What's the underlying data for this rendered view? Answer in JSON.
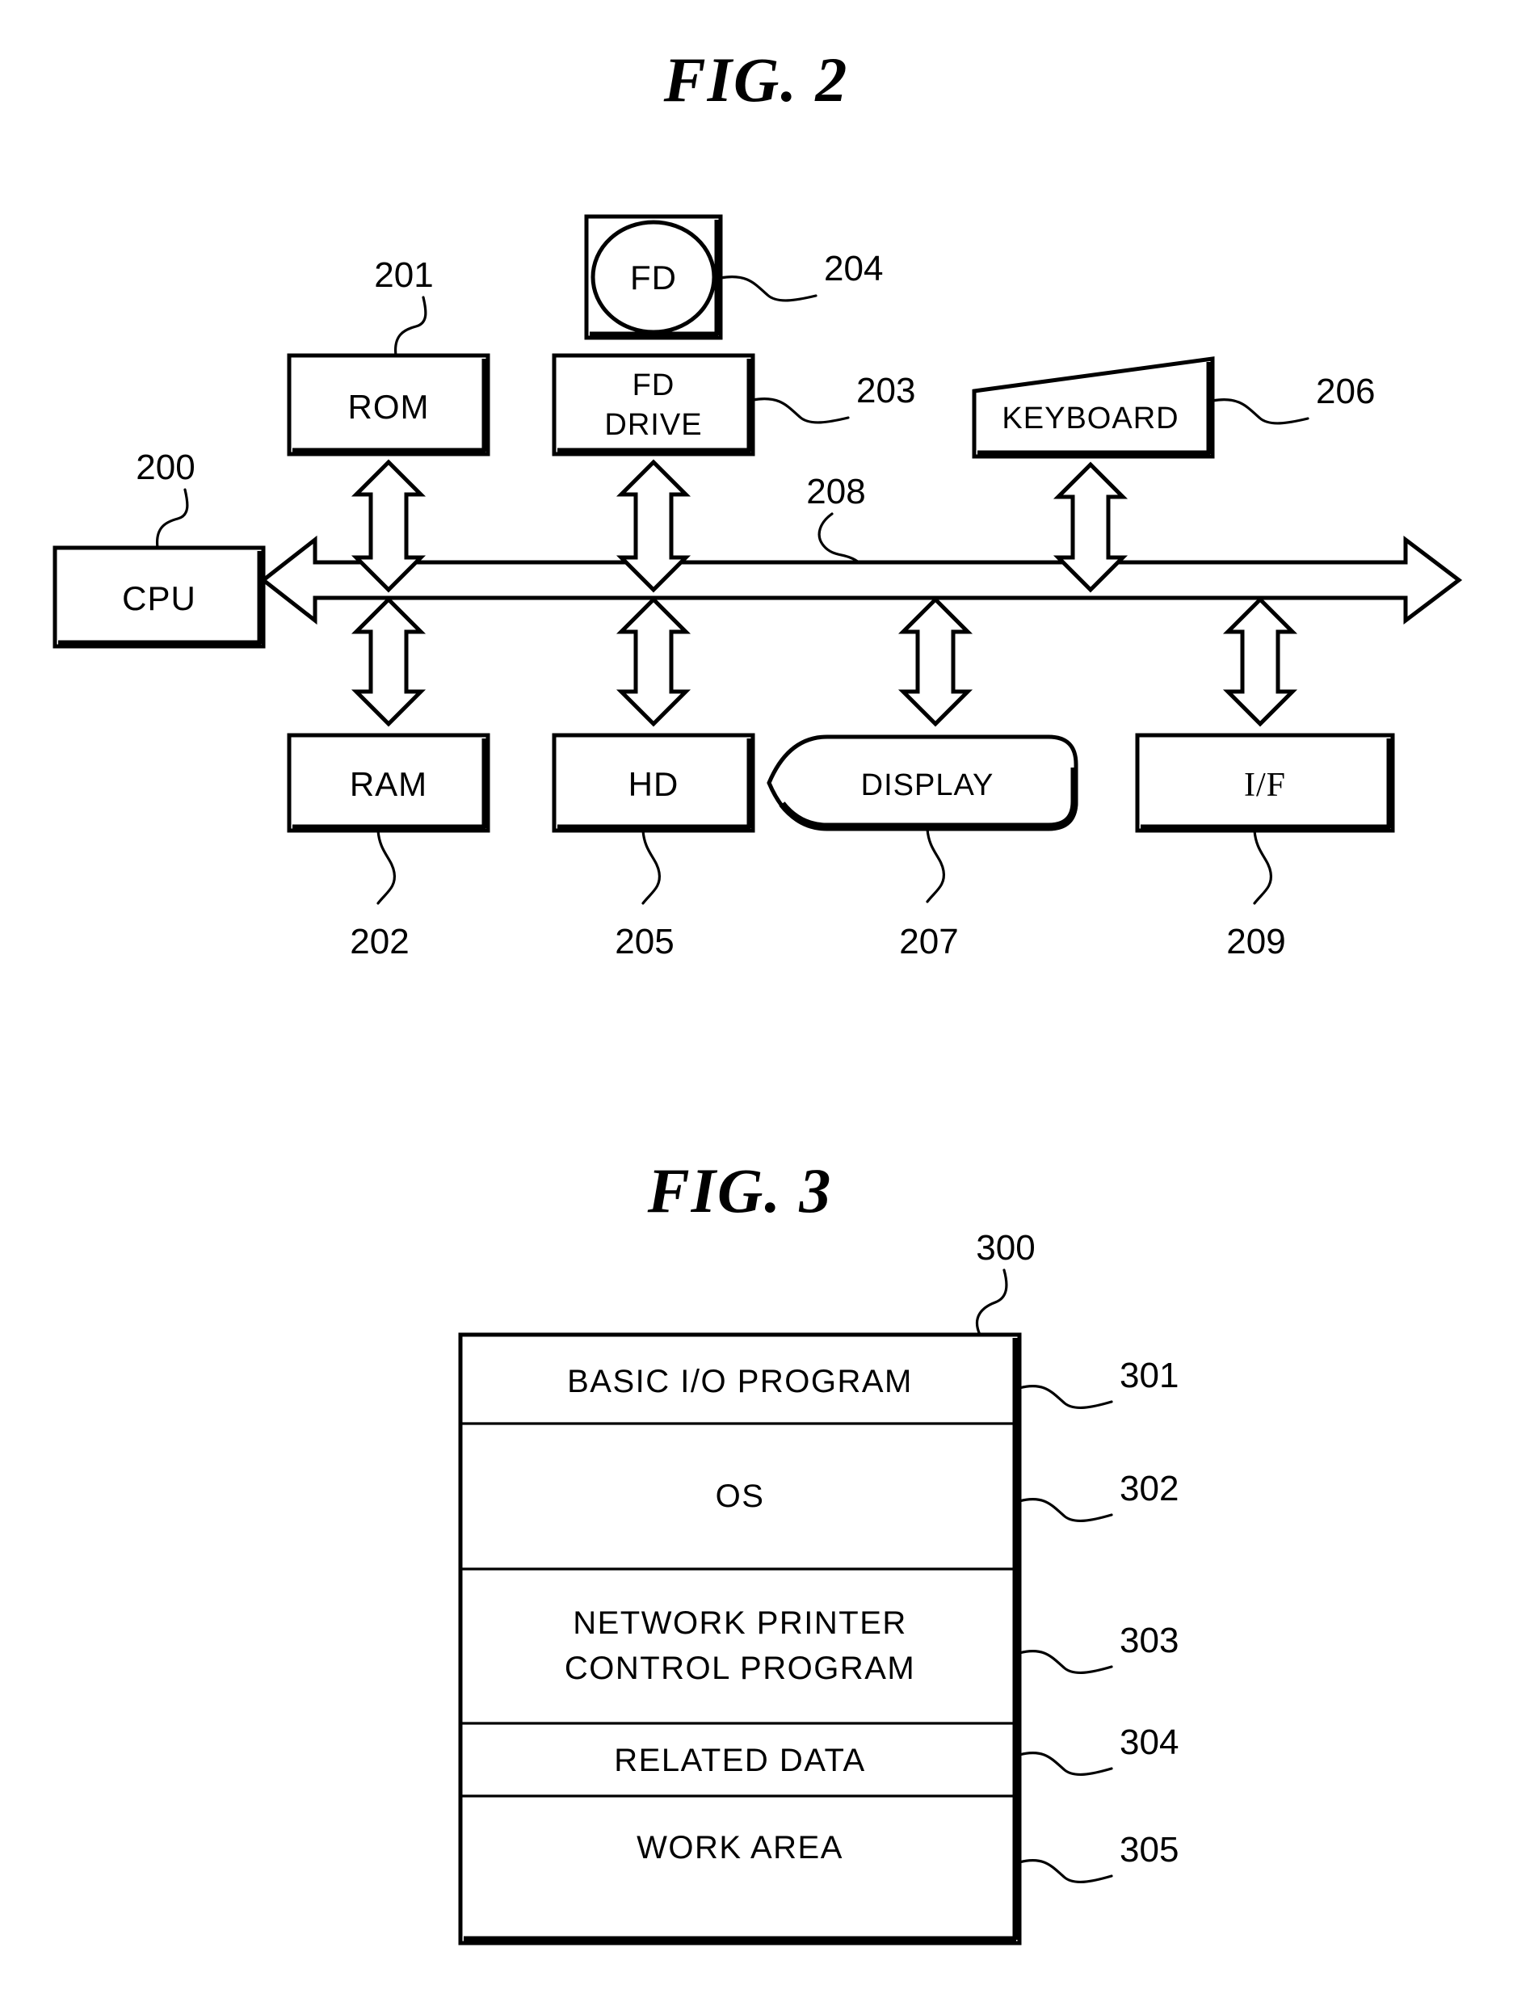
{
  "sheet": {
    "background": "#ffffff",
    "ink": "#000000"
  },
  "figures": [
    {
      "id": "fig2",
      "title": "FIG.  2",
      "caption_number": "2",
      "nodes": [
        {
          "key": "cpu",
          "label": "CPU",
          "ref": "200",
          "shape": "rect-shadow"
        },
        {
          "key": "rom",
          "label": "ROM",
          "ref": "201",
          "shape": "rect-shadow"
        },
        {
          "key": "ram",
          "label": "RAM",
          "ref": "202",
          "shape": "rect-shadow"
        },
        {
          "key": "fd_drive",
          "label": "FD DRIVE",
          "ref": "203",
          "shape": "rect-shadow",
          "line1": "FD",
          "line2": "DRIVE"
        },
        {
          "key": "fd",
          "label": "FD",
          "ref": "204",
          "shape": "disk"
        },
        {
          "key": "hd",
          "label": "HD",
          "ref": "205",
          "shape": "rect-shadow"
        },
        {
          "key": "keyboard",
          "label": "KEYBOARD",
          "ref": "206",
          "shape": "trapezoid"
        },
        {
          "key": "display",
          "label": "DISPLAY",
          "ref": "207",
          "shape": "crt"
        },
        {
          "key": "bus",
          "label": "",
          "ref": "208",
          "shape": "double-arrow-bus"
        },
        {
          "key": "interface",
          "label": "I/F",
          "ref": "209",
          "shape": "rect-shadow"
        }
      ]
    },
    {
      "id": "fig3",
      "title": "FIG.  3",
      "caption_number": "3",
      "memory_map_ref": "300",
      "rows": [
        {
          "label": "BASIC I/O PROGRAM",
          "ref": "301",
          "lines": [
            "BASIC I/O PROGRAM"
          ]
        },
        {
          "label": "OS",
          "ref": "302",
          "lines": [
            "OS"
          ]
        },
        {
          "label": "NETWORK PRINTER CONTROL PROGRAM",
          "ref": "303",
          "lines": [
            "NETWORK  PRINTER",
            "CONTROL  PROGRAM"
          ]
        },
        {
          "label": "RELATED DATA",
          "ref": "304",
          "lines": [
            "RELATED  DATA"
          ]
        },
        {
          "label": "WORK AREA",
          "ref": "305",
          "lines": [
            "WORK  AREA"
          ]
        }
      ]
    }
  ]
}
